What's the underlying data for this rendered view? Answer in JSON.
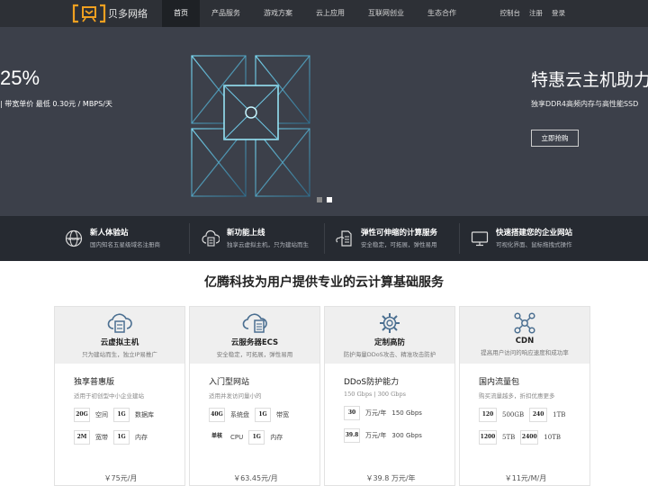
{
  "nav": {
    "logo_text": "贝多网络",
    "items": [
      "首页",
      "产品服务",
      "游戏方案",
      "云上应用",
      "互联网创业",
      "生态合作"
    ],
    "right": [
      "控制台",
      "注册",
      "登录"
    ]
  },
  "hero": {
    "left_pct": "25%",
    "left_sub": "| 带宽单价 最低 0.30元 / MBPS/天",
    "right_title": "特惠云主机助力",
    "right_sub": "独享DDR4高频内存与高性能SSD",
    "button": "立即抢购"
  },
  "features": [
    {
      "title": "新人体验站",
      "desc": "国内知名五星级域名注册商",
      "icon": "globe-www-icon"
    },
    {
      "title": "新功能上线",
      "desc": "独享云虚拟主机，只为建站而生",
      "icon": "cloud-server-icon"
    },
    {
      "title": "弹性可伸缩的计算服务",
      "desc": "安全稳定，可拓展，弹性易用",
      "icon": "document-cloud-icon"
    },
    {
      "title": "快速搭建您的企业网站",
      "desc": "可视化界面、鼠标拖拽式操作",
      "icon": "monitor-icon"
    }
  ],
  "section_title": "亿腾科技为用户提供专业的云计算基础服务",
  "cards": [
    {
      "name": "云虚拟主机",
      "desc": "只为建站而生，独立IP易推广",
      "icon": "cloud-host-icon",
      "plan_title": "独享普惠版",
      "plan_desc": "适用于初创型中小企业建站",
      "specs": [
        [
          "20G",
          "空间"
        ],
        [
          "1G",
          "数据库"
        ],
        [
          "2M",
          "宽带"
        ],
        [
          "1G",
          "内存"
        ]
      ],
      "price": "￥75元/月"
    },
    {
      "name": "云服务器ECS",
      "desc": "安全稳定，可拓展，弹性易用",
      "icon": "cloud-ecs-icon",
      "plan_title": "入门型网站",
      "plan_desc": "适用并发访问量小的",
      "specs": [
        [
          "40G",
          "系统盘"
        ],
        [
          "1G",
          "带宽"
        ],
        [
          "单核",
          "CPU"
        ],
        [
          "1G",
          "内存"
        ]
      ],
      "price": "￥63.45元/月"
    },
    {
      "name": "定制高防",
      "desc": "防护海量DDoS攻击、精准攻击防护",
      "icon": "gear-shield-icon",
      "plan_title": "DDoS防护能力",
      "plan_desc": "150 Gbps | 300 Gbps",
      "specs": [
        [
          "30",
          "万元/年",
          "150 Gbps"
        ],
        [
          "39.8",
          "万元/年",
          "300 Gbps"
        ]
      ],
      "price": "￥39.8 万元/年"
    },
    {
      "name": "CDN",
      "desc": "提高用户访问的响应速度和成功率",
      "icon": "network-nodes-icon",
      "plan_title": "国内流量包",
      "plan_desc": "购买流量越多，折扣优惠更多",
      "specs": [
        [
          "120",
          "500GB"
        ],
        [
          "240",
          "1TB"
        ],
        [
          "1200",
          "5TB"
        ],
        [
          "2400",
          "10TB"
        ]
      ],
      "price": "￥11元/M/月"
    }
  ]
}
